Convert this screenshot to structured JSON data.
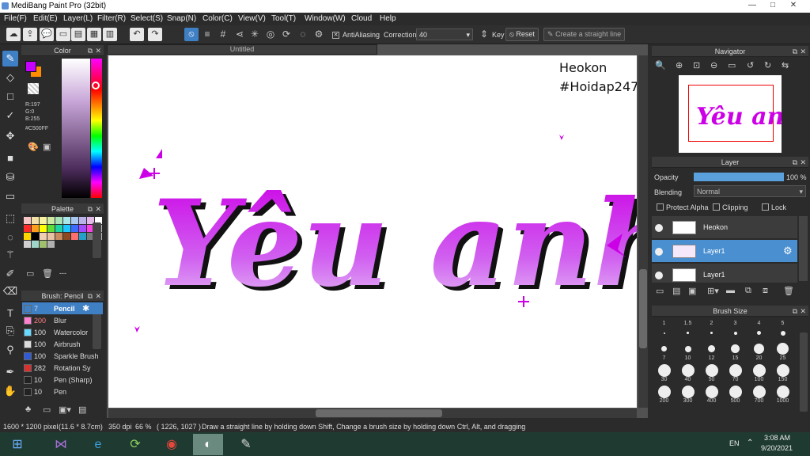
{
  "window": {
    "title": "MediBang Paint Pro (32bit)",
    "min": "—",
    "max": "□",
    "close": "✕"
  },
  "menu": [
    "File(F)",
    "Edit(E)",
    "Layer(L)",
    "Filter(R)",
    "Select(S)",
    "Snap(N)",
    "Color(C)",
    "View(V)",
    "Tool(T)",
    "Window(W)",
    "Cloud",
    "Help"
  ],
  "toolbar": {
    "antialiasing_label": "AntiAliasing",
    "correction_label": "Correction",
    "correction_value": "40",
    "key_label": "Key",
    "reset_label": "Reset",
    "straight_line_label": "Create a straight line"
  },
  "color_panel": {
    "title": "Color",
    "r": "R:197",
    "g": "G:0",
    "b": "B:255",
    "hex": "#C500FF",
    "primary": "#C500FF",
    "secondary": "#FF8C00"
  },
  "palette": {
    "title": "Palette",
    "colors": [
      "#f7c5c5",
      "#f2e0a6",
      "#f6f19e",
      "#cde9a3",
      "#a7e3b7",
      "#a9e8ea",
      "#aac8ef",
      "#b9b2ea",
      "#e3b7e8",
      "#ffffff",
      "#ff2b2b",
      "#ff9d1f",
      "#ffff00",
      "#5edc37",
      "#1ed3a4",
      "#1ec6ff",
      "#3b6bff",
      "#a24bff",
      "#ff3fe2",
      "#c0c0c0",
      "#ffd700",
      "#000000",
      "#f0d0b0",
      "#e9c4a2",
      "#c88b5e",
      "#8b4a22",
      "#ff6f6f",
      "#23a1c9",
      "#7a7a7a",
      "#bbbbbb",
      "#d0d0d0",
      "#9fd6c9",
      "#a0c070",
      "#b0b0b0"
    ]
  },
  "brush_panel": {
    "title": "Brush: Pencil",
    "items": [
      {
        "size": "7",
        "name": "Pencil",
        "color": "#3f7fc4"
      },
      {
        "size": "200",
        "name": "Blur",
        "color": "#ff7fd1"
      },
      {
        "size": "100",
        "name": "Watercolor",
        "color": "#66d9ff"
      },
      {
        "size": "100",
        "name": "Airbrush",
        "color": "#dddddd"
      },
      {
        "size": "100",
        "name": "Sparkle Brush",
        "color": "#2f5bd9"
      },
      {
        "size": "282",
        "name": "Rotation Sy",
        "color": "#d93030"
      },
      {
        "size": "10",
        "name": "Pen (Sharp)",
        "color": "#222222"
      },
      {
        "size": "10",
        "name": "Pen",
        "color": "#222222"
      }
    ]
  },
  "document": {
    "tab_title": "Untitled",
    "watermark_line1": "Heokon",
    "watermark_line2": "#Hoidap247",
    "art_text": "Yêu anh"
  },
  "navigator": {
    "title": "Navigator"
  },
  "layer_panel": {
    "title": "Layer",
    "opacity_label": "Opacity",
    "opacity_value": "100 %",
    "opacity_fraction": 1.0,
    "blending_label": "Blending",
    "blending_value": "Normal",
    "protect_alpha": "Protect Alpha",
    "clipping": "Clipping",
    "lock": "Lock",
    "layers": [
      {
        "name": "Heokon",
        "selected": false
      },
      {
        "name": "Layer1",
        "selected": true
      },
      {
        "name": "Layer1",
        "selected": false
      }
    ]
  },
  "brush_size_panel": {
    "title": "Brush Size",
    "sizes": [
      "1",
      "1.5",
      "2",
      "3",
      "4",
      "5",
      "7",
      "10",
      "12",
      "15",
      "20",
      "25",
      "30",
      "40",
      "50",
      "70",
      "100",
      "150",
      "200",
      "300",
      "400",
      "500",
      "700",
      "1000"
    ]
  },
  "status": {
    "dimensions": "1600 * 1200 pixel",
    "physical": "(11.6 * 8.7cm)",
    "dpi": "350 dpi",
    "zoom": "66 %",
    "cursor": "( 1226, 1027 )",
    "hint": "Draw a straight line by holding down Shift, Change a brush size by holding down Ctrl, Alt, and dragging"
  },
  "taskbar": {
    "lang": "EN",
    "time": "3:08 AM",
    "date": "9/20/2021"
  }
}
